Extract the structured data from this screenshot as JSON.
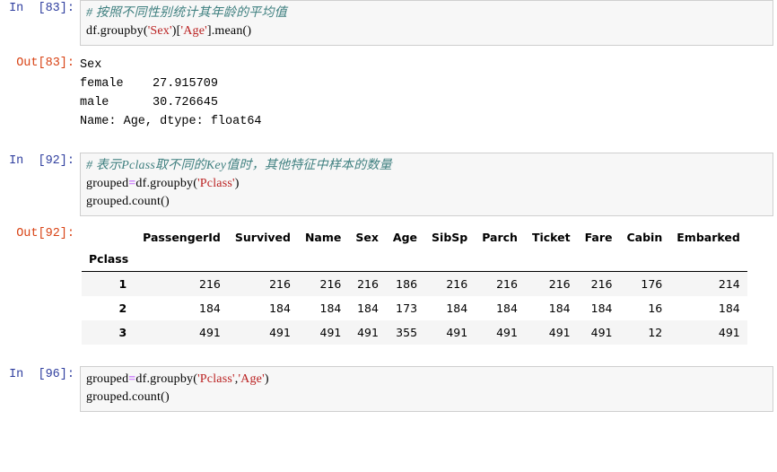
{
  "notebook": {
    "cells": [
      {
        "kind": "input",
        "prompt": "In  [83]:",
        "lines": [
          [
            {
              "t": "# 按照不同性别统计其年龄的平均值",
              "c": "comment"
            }
          ],
          [
            {
              "t": "df.groupby(",
              "c": "plain"
            },
            {
              "t": "'Sex'",
              "c": "str"
            },
            {
              "t": ")[",
              "c": "plain"
            },
            {
              "t": "'Age'",
              "c": "str"
            },
            {
              "t": "].mean()",
              "c": "plain"
            }
          ]
        ]
      },
      {
        "kind": "text-output",
        "prompt": "Out[83]:",
        "lines": [
          "Sex",
          "female    27.915709",
          "male      30.726645",
          "Name: Age, dtype: float64"
        ]
      },
      {
        "kind": "input",
        "prompt": "In  [92]:",
        "lines": [
          [
            {
              "t": "# 表示Pclass取不同的Key值时，其他特征中样本的数量",
              "c": "comment"
            }
          ],
          [
            {
              "t": "grouped",
              "c": "plain"
            },
            {
              "t": "=",
              "c": "op"
            },
            {
              "t": "df.groupby(",
              "c": "plain"
            },
            {
              "t": "'Pclass'",
              "c": "str"
            },
            {
              "t": ")",
              "c": "plain"
            }
          ],
          [
            {
              "t": "grouped.count()",
              "c": "plain"
            }
          ]
        ]
      },
      {
        "kind": "table-output",
        "prompt": "Out[92]:",
        "table": {
          "index_name": "Pclass",
          "columns": [
            "PassengerId",
            "Survived",
            "Name",
            "Sex",
            "Age",
            "SibSp",
            "Parch",
            "Ticket",
            "Fare",
            "Cabin",
            "Embarked"
          ],
          "index": [
            "1",
            "2",
            "3"
          ],
          "rows": [
            [
              "216",
              "216",
              "216",
              "216",
              "186",
              "216",
              "216",
              "216",
              "216",
              "176",
              "214"
            ],
            [
              "184",
              "184",
              "184",
              "184",
              "173",
              "184",
              "184",
              "184",
              "184",
              "16",
              "184"
            ],
            [
              "491",
              "491",
              "491",
              "491",
              "355",
              "491",
              "491",
              "491",
              "491",
              "12",
              "491"
            ]
          ]
        }
      },
      {
        "kind": "input",
        "prompt": "In  [96]:",
        "lines": [
          [
            {
              "t": "grouped",
              "c": "plain"
            },
            {
              "t": "=",
              "c": "op"
            },
            {
              "t": "df.groupby(",
              "c": "plain"
            },
            {
              "t": "'Pclass'",
              "c": "str"
            },
            {
              "t": ",",
              "c": "plain"
            },
            {
              "t": "'Age'",
              "c": "str"
            },
            {
              "t": ")",
              "c": "plain"
            }
          ],
          [
            {
              "t": "grouped.count()",
              "c": "plain"
            }
          ]
        ]
      }
    ]
  },
  "colors": {
    "prompt_in": "#303f9f",
    "prompt_out": "#d84315",
    "comment": "#408080",
    "string": "#ba2121",
    "operator": "#aa22ff",
    "input_background": "#f7f7f7",
    "input_border": "#cfcfcf",
    "table_stripe": "#f5f5f5",
    "page_background": "#ffffff"
  }
}
